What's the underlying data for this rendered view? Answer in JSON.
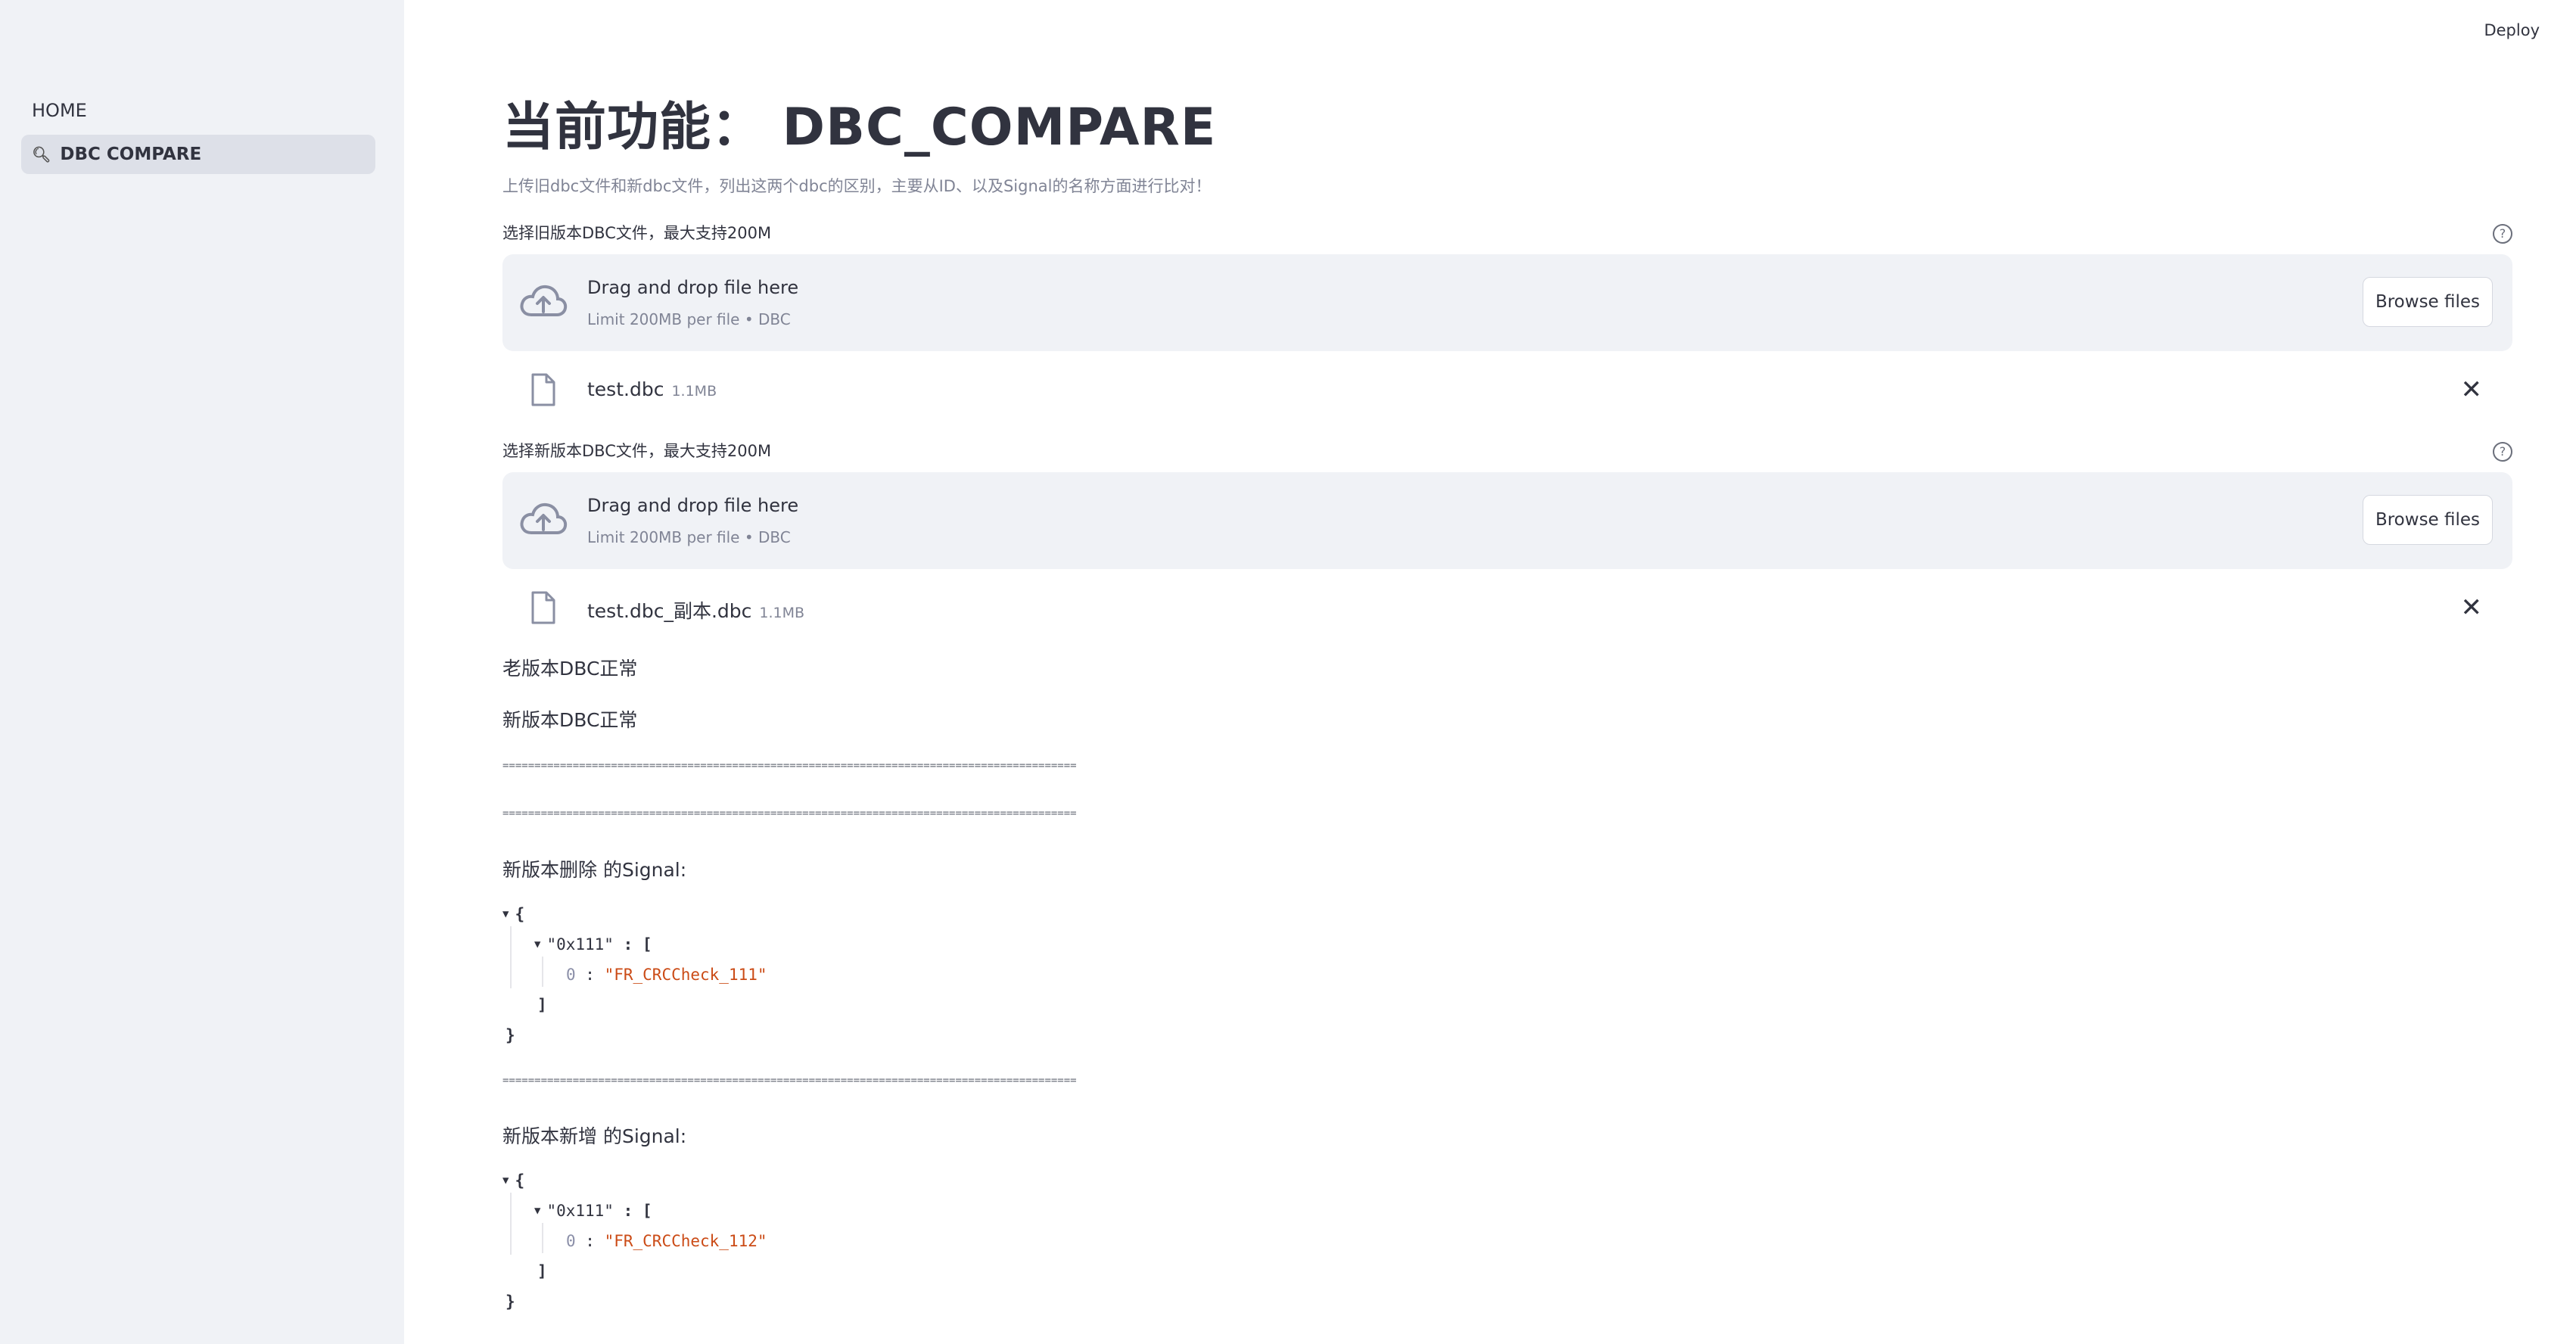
{
  "sidebar": {
    "items": [
      {
        "label": "HOME",
        "icon": ""
      },
      {
        "label": "DBC COMPARE",
        "icon": "search-icon"
      }
    ]
  },
  "header": {
    "deploy_label": "Deploy"
  },
  "main": {
    "title": "当前功能： DBC_COMPARE",
    "description": "上传旧dbc文件和新dbc文件，列出这两个dbc的区别，主要从ID、以及Signal的名称方面进行比对！",
    "uploaders": [
      {
        "label": "选择旧版本DBC文件，最大支持200M",
        "help_icon": "?",
        "drop_text": "Drag and drop file here",
        "limit_text": "Limit 200MB per file • DBC",
        "browse_label": "Browse files",
        "file": {
          "name": "test.dbc",
          "size": "1.1MB"
        }
      },
      {
        "label": "选择新版本DBC文件，最大支持200M",
        "help_icon": "?",
        "drop_text": "Drag and drop file here",
        "limit_text": "Limit 200MB per file • DBC",
        "browse_label": "Browse files",
        "file": {
          "name": "test.dbc_副本.dbc",
          "size": "1.1MB"
        }
      }
    ],
    "status_old": "老版本DBC正常",
    "status_new": "新版本DBC正常",
    "separator": "==========================================================================================",
    "deleted": {
      "heading": "新版本删除 的Signal:",
      "open_brace": "{",
      "key": "\"0x111\"",
      "colon_bracket": " : [",
      "index": "0",
      "colon": " : ",
      "value": "\"FR_CRCCheck_111\"",
      "close_bracket": "]",
      "close_brace": "}"
    },
    "added": {
      "heading": "新版本新增 的Signal:",
      "open_brace": "{",
      "key": "\"0x111\"",
      "colon_bracket": " : [",
      "index": "0",
      "colon": " : ",
      "value": "\"FR_CRCCheck_112\"",
      "close_bracket": "]",
      "close_brace": "}"
    }
  }
}
